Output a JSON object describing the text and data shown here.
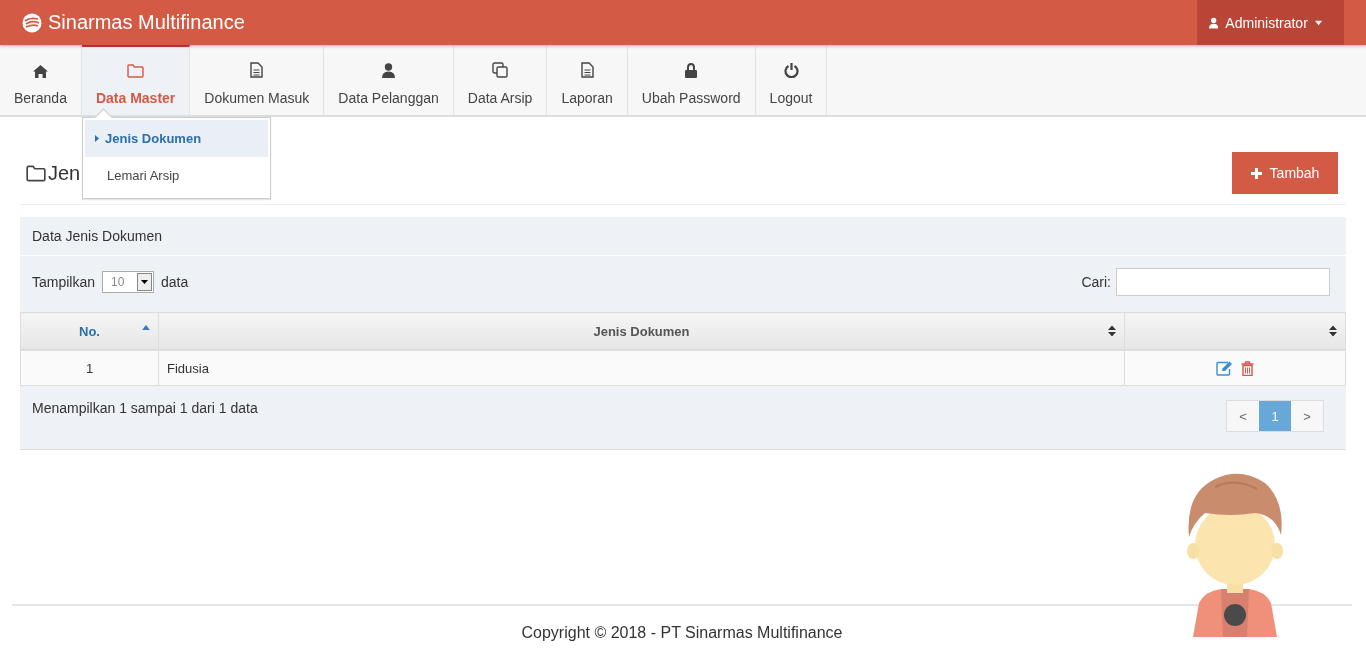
{
  "header": {
    "brand": "Sinarmas Multifinance",
    "user": "Administrator"
  },
  "nav": [
    {
      "label": "Beranda",
      "selected": false
    },
    {
      "label": "Data Master",
      "selected": true
    },
    {
      "label": "Dokumen Masuk",
      "selected": false
    },
    {
      "label": "Data Pelanggan",
      "selected": false
    },
    {
      "label": "Data Arsip",
      "selected": false
    },
    {
      "label": "Laporan",
      "selected": false
    },
    {
      "label": "Ubah Password",
      "selected": false
    },
    {
      "label": "Logout",
      "selected": false
    }
  ],
  "dropdown": {
    "items": [
      {
        "label": "Jenis Dokumen",
        "selected": true
      },
      {
        "label": "Lemari Arsip",
        "selected": false
      }
    ]
  },
  "page": {
    "title": "Jen",
    "add_button": "Tambah"
  },
  "panel": {
    "title": "Data Jenis Dokumen",
    "length_label": "Tampilkan",
    "length_value": "10",
    "length_suffix": "data",
    "search_label": "Cari:",
    "table": {
      "columns": [
        {
          "label": "No.",
          "sorted": true
        },
        {
          "label": "Jenis Dokumen",
          "sorted": false
        },
        {
          "sorted": false
        }
      ],
      "rows": [
        {
          "no": "1",
          "jenis_dokumen": "Fidusia"
        }
      ]
    },
    "info": "Menampilkan 1 sampai 1 dari 1 data",
    "pagination": [
      {
        "label": "<",
        "selected": false
      },
      {
        "label": "1",
        "selected": true
      },
      {
        "label": ">",
        "selected": false
      }
    ]
  },
  "footer": {
    "copyright": "Copyright © 2018 - PT Sinarmas Multifinance"
  }
}
